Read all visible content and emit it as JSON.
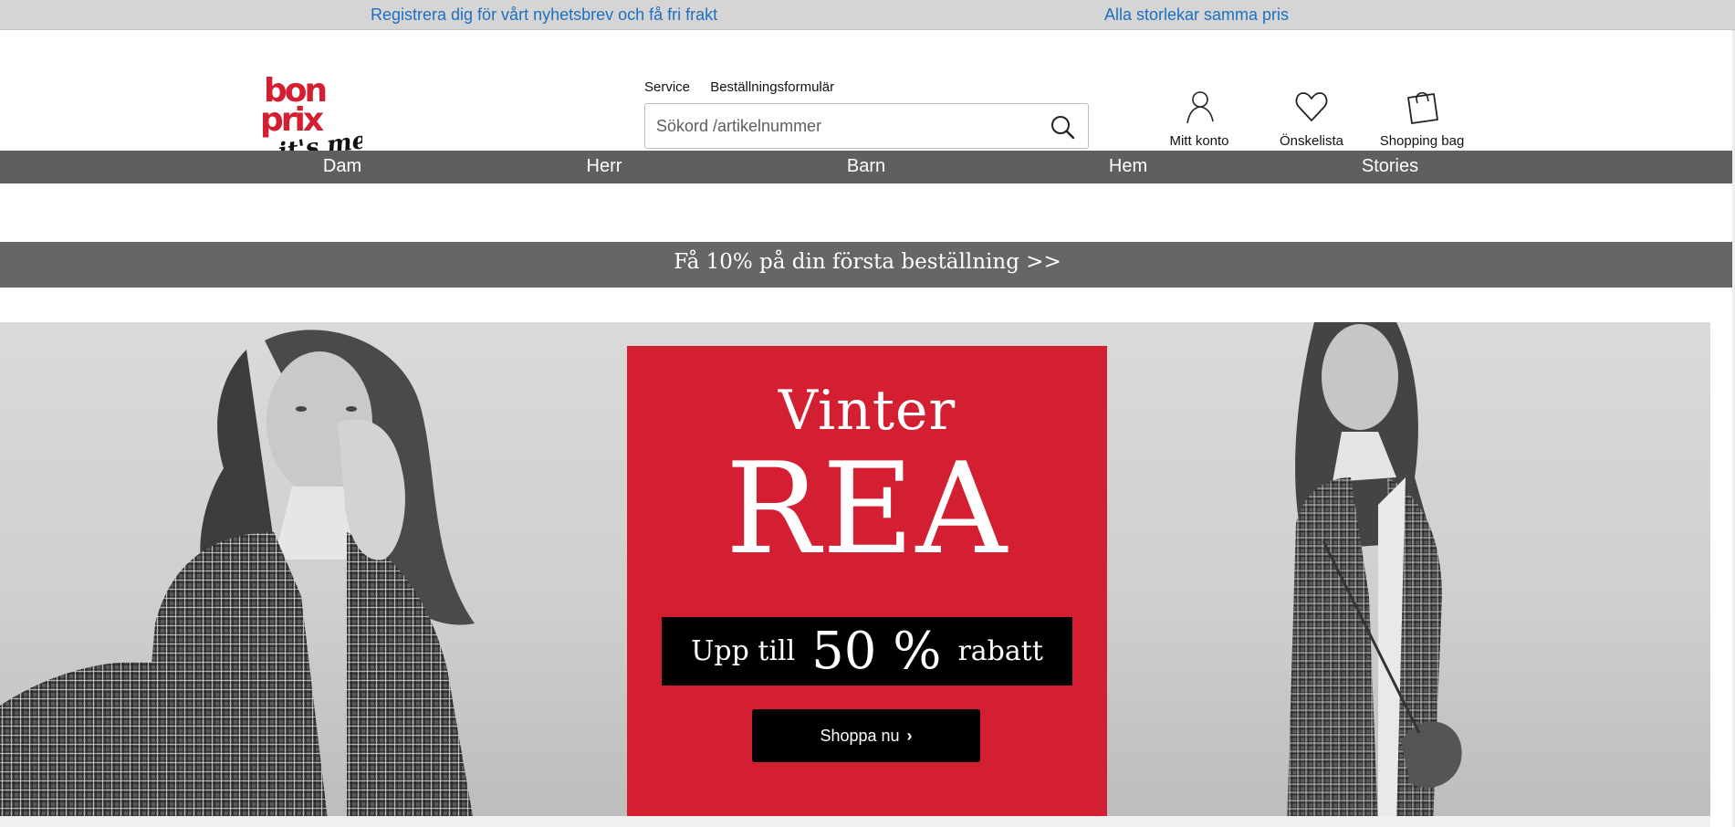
{
  "topbar": {
    "newsletter_link": "Registrera dig för vårt nyhetsbrev och få fri frakt",
    "sizes_link": "Alla storlekar samma pris"
  },
  "header": {
    "logo_text": "bonprix it's me!",
    "service_link": "Service",
    "order_form_link": "Beställningsformulär",
    "search": {
      "placeholder": "Sökord /artikelnummer",
      "icon": "search-icon"
    },
    "account": {
      "label": "Mitt konto",
      "icon": "user-icon"
    },
    "wishlist": {
      "label": "Önskelista",
      "icon": "heart-icon"
    },
    "bag": {
      "label": "Shopping bag",
      "icon": "shopping-bag-icon"
    }
  },
  "nav": {
    "items": [
      "Dam",
      "Herr",
      "Barn",
      "Hem",
      "Stories"
    ]
  },
  "promo": {
    "text": "Få 10% på din första beställning >>"
  },
  "hero": {
    "title_small": "Vinter",
    "title_big": "REA",
    "discount_prefix": "Upp till",
    "discount_value": "50 %",
    "discount_suffix": "rabatt",
    "cta": "Shoppa nu"
  },
  "colors": {
    "brand_red": "#d31f31",
    "nav_gray": "#5f5f5f",
    "promo_gray": "#666666",
    "link_blue": "#1f6fbf"
  }
}
